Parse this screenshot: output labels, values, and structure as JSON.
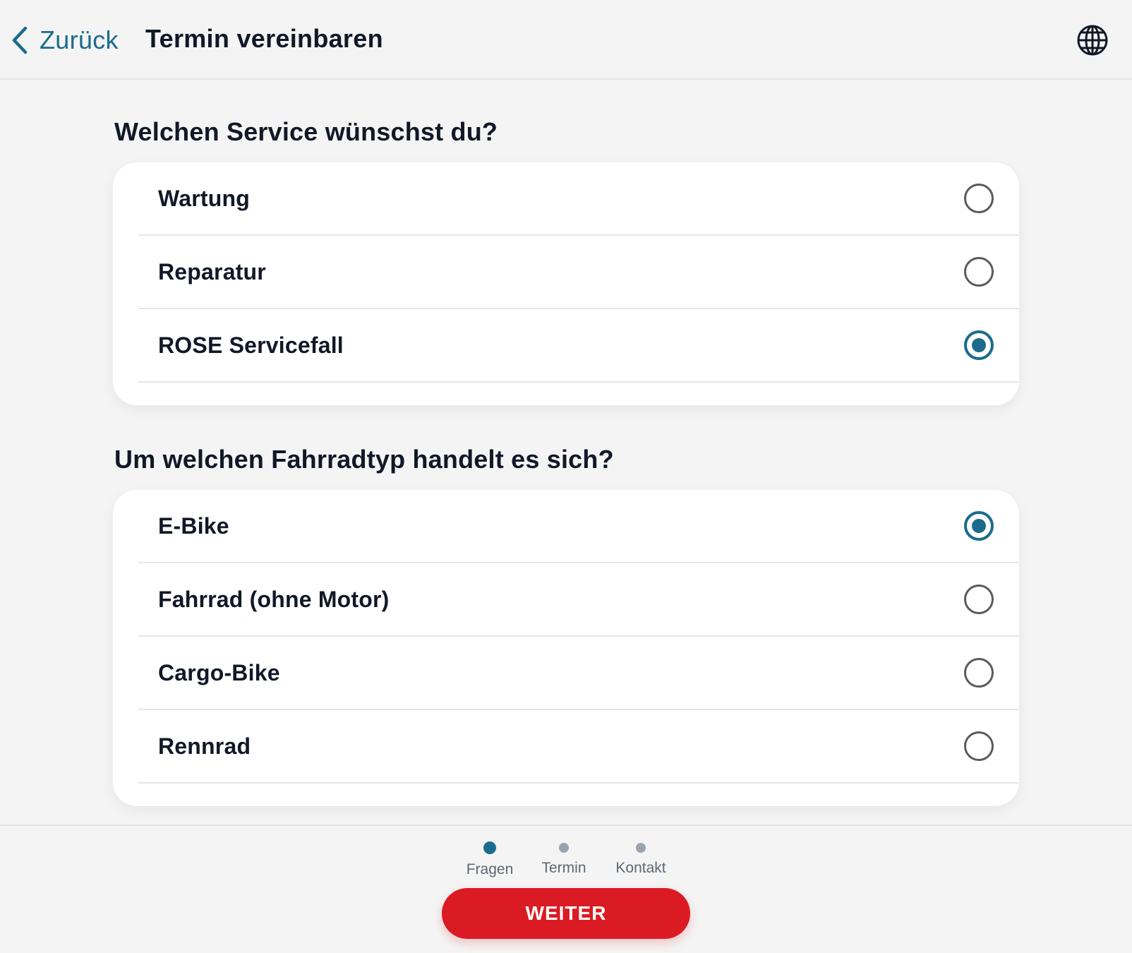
{
  "header": {
    "back_label": "Zurück",
    "title": "Termin vereinbaren",
    "language_icon": "globe-icon"
  },
  "service_question": {
    "title": "Welchen Service wünschst du?",
    "options": [
      {
        "label": "Wartung",
        "selected": false
      },
      {
        "label": "Reparatur",
        "selected": false
      },
      {
        "label": "ROSE Servicefall",
        "selected": true
      }
    ]
  },
  "bike_question": {
    "title": "Um welchen Fahrradtyp handelt es sich?",
    "options": [
      {
        "label": "E-Bike",
        "selected": true
      },
      {
        "label": "Fahrrad (ohne Motor)",
        "selected": false
      },
      {
        "label": "Cargo-Bike",
        "selected": false
      },
      {
        "label": "Rennrad",
        "selected": false
      }
    ]
  },
  "progress": {
    "steps": [
      {
        "label": "Fragen",
        "active": true
      },
      {
        "label": "Termin",
        "active": false
      },
      {
        "label": "Kontakt",
        "active": false
      }
    ]
  },
  "footer": {
    "next_label": "WEITER"
  },
  "colors": {
    "accent": "#1b6b8c",
    "primary_button": "#db1b23",
    "background": "#f4f4f4"
  }
}
